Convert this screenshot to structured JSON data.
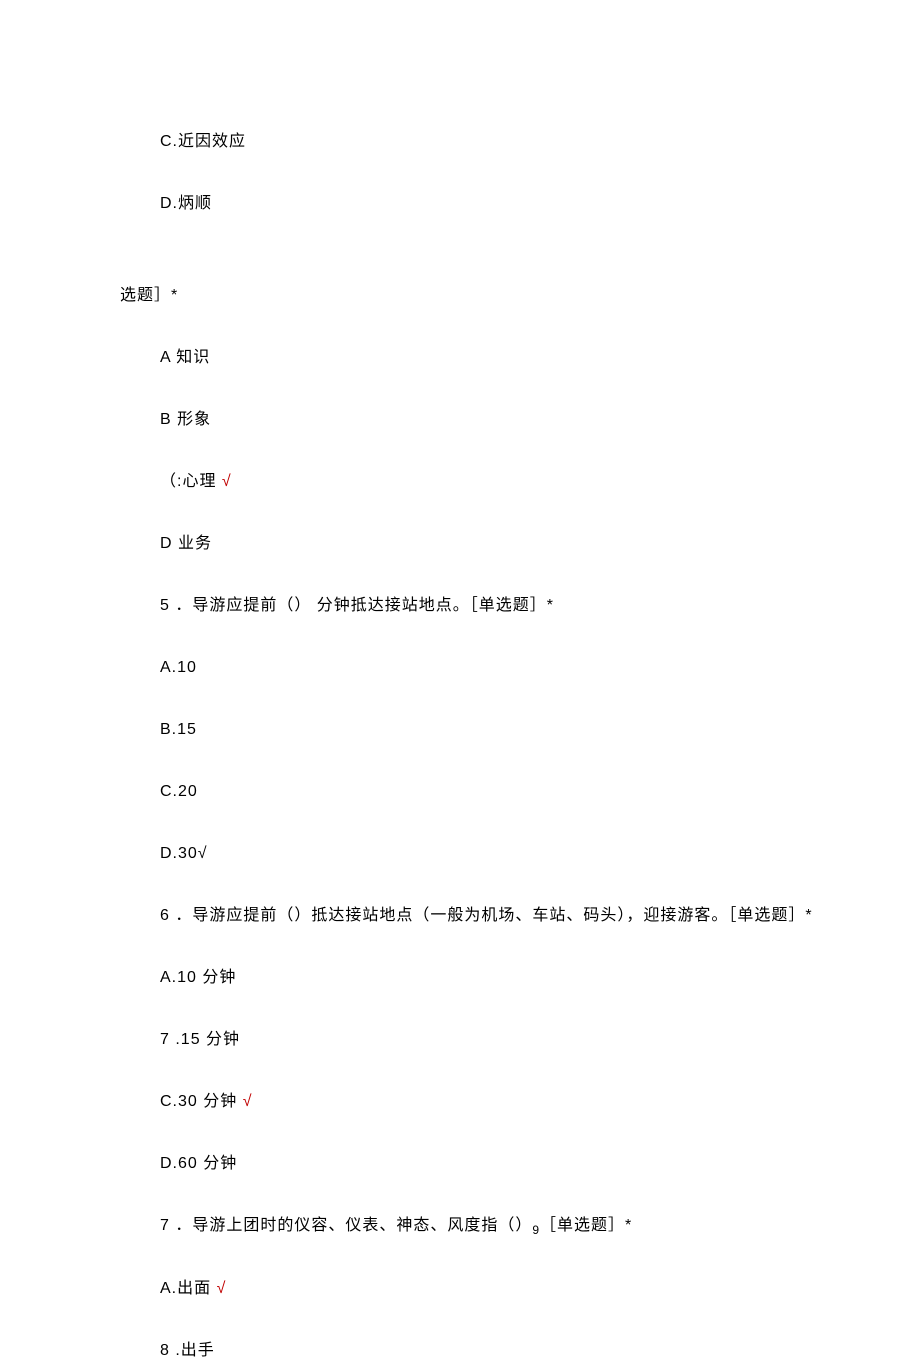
{
  "lines": {
    "l1": "C.近因效应",
    "l2": "D.炳顺",
    "l3": "选题］*",
    "l4": "A 知识",
    "l5": "B 形象",
    "l6_prefix": "（:心理 ",
    "l7": "D 业务",
    "l8": "5 ．导游应提前（） 分钟抵达接站地点。［单选题］*",
    "l9": "A.10",
    "l10": "B.15",
    "l11": "C.20",
    "l12": "D.30√",
    "l13": "6 ．导游应提前（）抵达接站地点（一般为机场、车站、码头），迎接游客。［单选题］*",
    "l14": "A.10 分钟",
    "l15": "7  .15 分钟",
    "l16_prefix": "C.30 分钟 ",
    "l17": "D.60 分钟",
    "l18_a": "7 ．导游上团时的仪容、仪表、神态、风度指（）",
    "l18_sub": "9",
    "l18_b": "［单选题］*",
    "l19_prefix": "A.出面 ",
    "l20": "8  .出手"
  },
  "check": "√"
}
